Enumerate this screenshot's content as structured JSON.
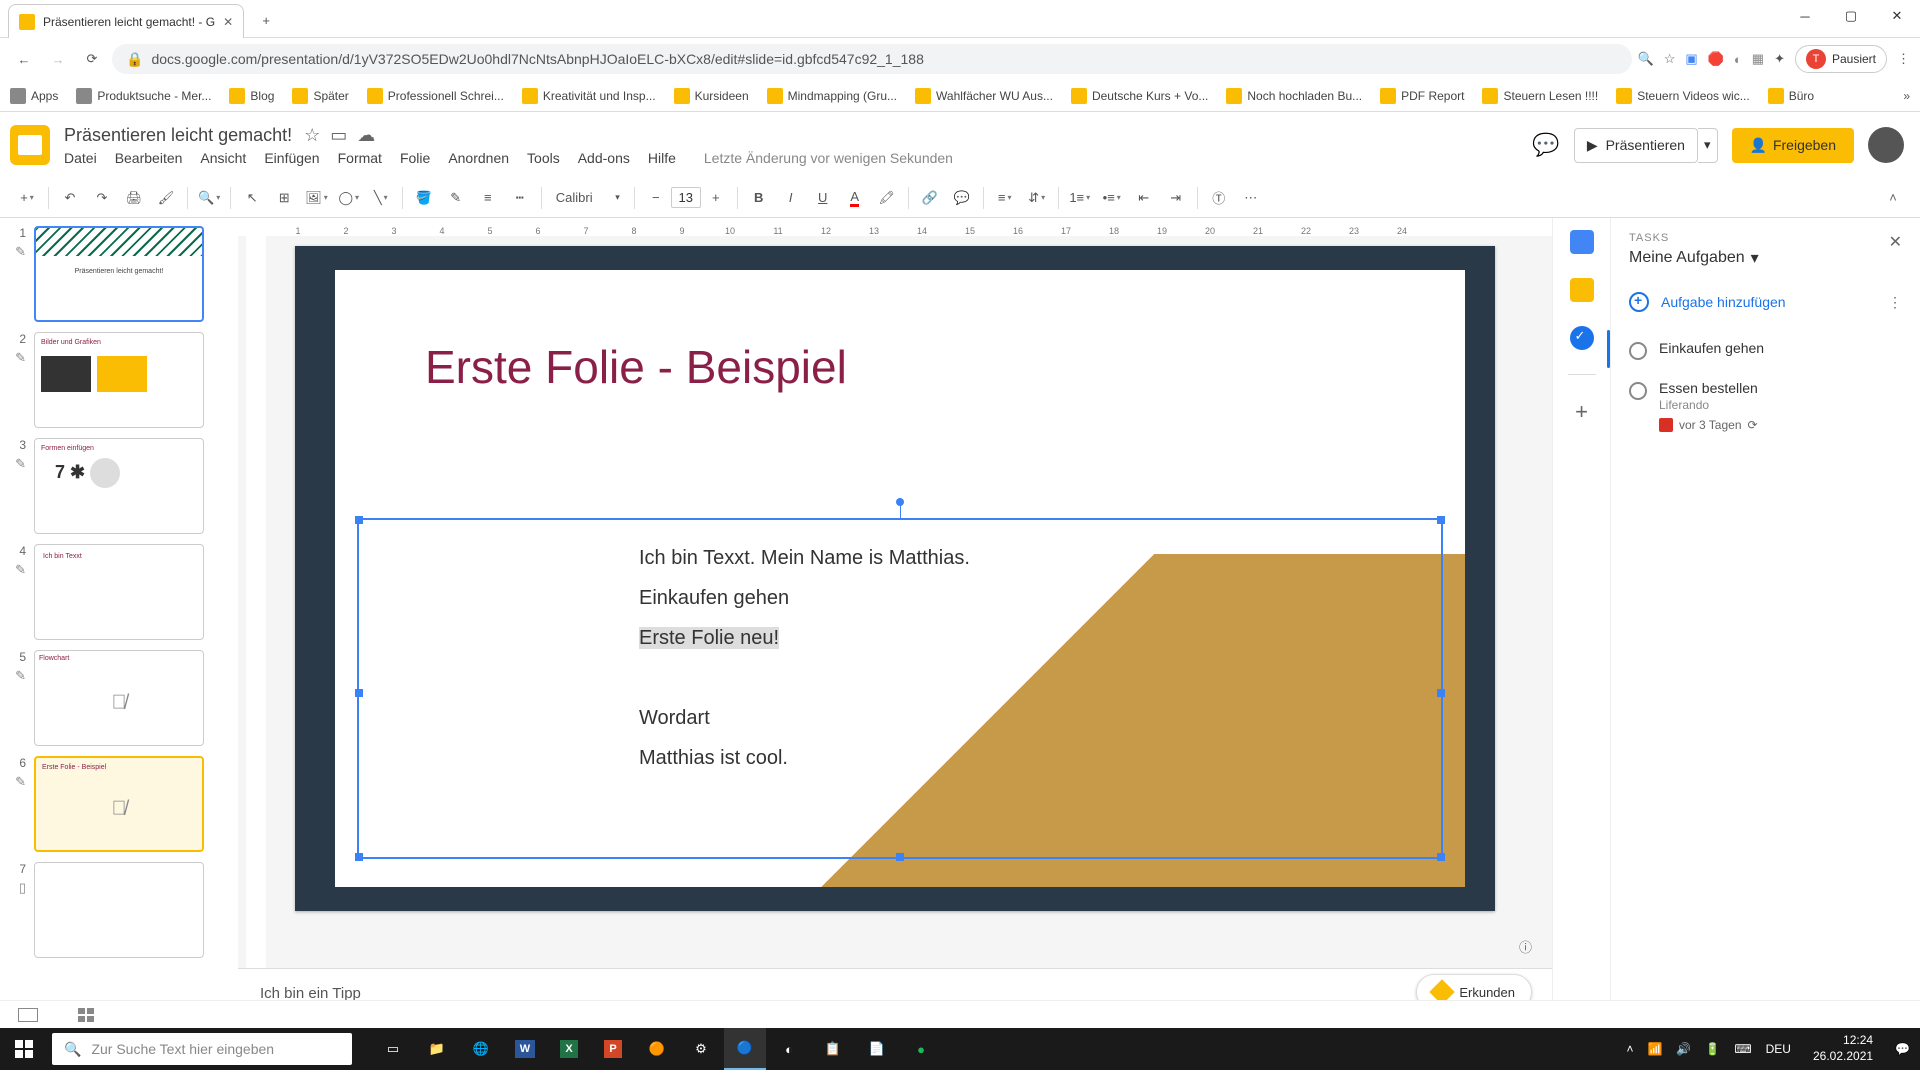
{
  "browser": {
    "tab_title": "Präsentieren leicht gemacht! - G",
    "url": "docs.google.com/presentation/d/1yV372SO5EDw2Uo0hdl7NcNtsAbnpHJOaIoELC-bXCx8/edit#slide=id.gbfcd547c92_1_188",
    "profile": "Pausiert",
    "profile_initial": "T"
  },
  "bookmarks": [
    "Apps",
    "Produktsuche - Mer...",
    "Blog",
    "Später",
    "Professionell Schrei...",
    "Kreativität und Insp...",
    "Kursideen",
    "Mindmapping (Gru...",
    "Wahlfächer WU Aus...",
    "Deutsche Kurs + Vo...",
    "Noch hochladen Bu...",
    "PDF Report",
    "Steuern Lesen !!!!",
    "Steuern Videos wic...",
    "Büro"
  ],
  "doc": {
    "title": "Präsentieren leicht gemacht!",
    "last_edit": "Letzte Änderung vor wenigen Sekunden"
  },
  "menus": [
    "Datei",
    "Bearbeiten",
    "Ansicht",
    "Einfügen",
    "Format",
    "Folie",
    "Anordnen",
    "Tools",
    "Add-ons",
    "Hilfe"
  ],
  "header_buttons": {
    "present": "Präsentieren",
    "share": "Freigeben"
  },
  "toolbar": {
    "font": "Calibri",
    "size": "13"
  },
  "slide": {
    "title": "Erste Folie - Beispiel",
    "lines": {
      "l1": "Ich bin Texxt. Mein Name is Matthias.",
      "l2": "Einkaufen gehen",
      "l3": "Erste Folie neu!",
      "l4": "Wordart",
      "l5": "Matthias ist cool."
    },
    "notes": "Ich bin ein Tipp"
  },
  "explore": "Erkunden",
  "thumbnails": {
    "t1_a": "Präsentieren leicht gemacht!",
    "t2_a": "Bilder und Grafiken",
    "t3_a": "Formen einfügen",
    "t3_b": "7 ✱",
    "t4_a": "Ich bin Texxt",
    "t5_a": "Flowchart",
    "t6_a": "Erste Folie - Beispiel"
  },
  "tasks": {
    "label": "TASKS",
    "list_name": "Meine Aufgaben",
    "add": "Aufgabe hinzufügen",
    "items": [
      {
        "title": "Einkaufen gehen"
      },
      {
        "title": "Essen bestellen",
        "sub": "Liferando",
        "date": "vor 3 Tagen"
      }
    ]
  },
  "windows": {
    "search_placeholder": "Zur Suche Text hier eingeben",
    "lang": "DEU",
    "time": "12:24",
    "date": "26.02.2021"
  }
}
